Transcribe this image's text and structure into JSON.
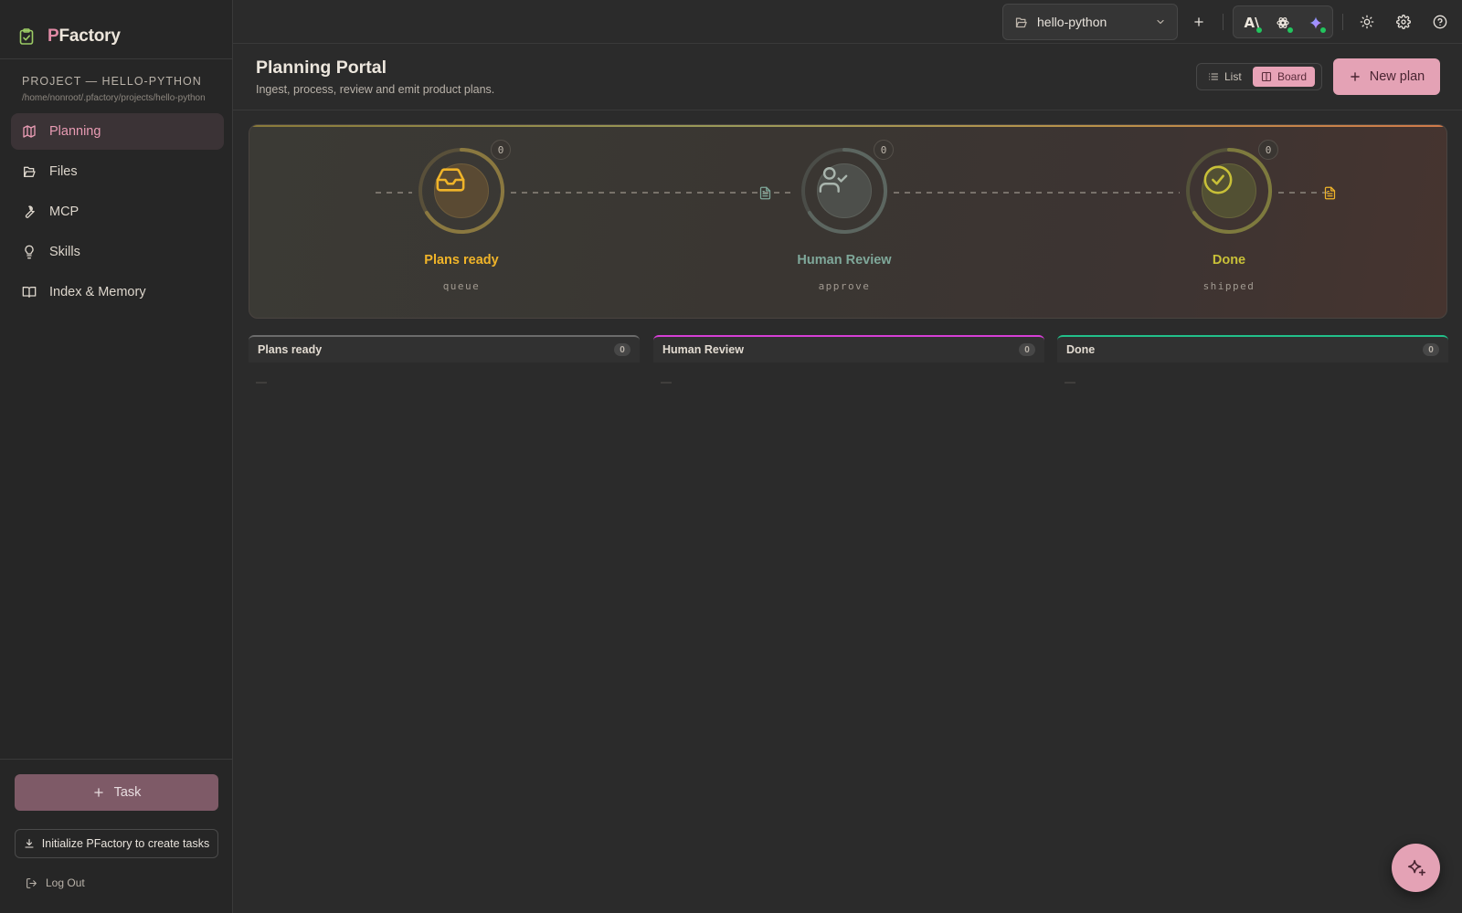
{
  "brand": {
    "prefix": "P",
    "name_rest": "Factory",
    "accent": "#e08aa5"
  },
  "project": {
    "label": "PROJECT — HELLO-PYTHON",
    "path": "/home/nonroot/.pfactory/projects/hello-python"
  },
  "sidebar": {
    "items": [
      {
        "label": "Planning",
        "icon": "map-icon",
        "active": true
      },
      {
        "label": "Files",
        "icon": "folder-open-icon",
        "active": false
      },
      {
        "label": "MCP",
        "icon": "wrench-icon",
        "active": false
      },
      {
        "label": "Skills",
        "icon": "lightbulb-icon",
        "active": false
      },
      {
        "label": "Index & Memory",
        "icon": "book-open-icon",
        "active": false
      }
    ],
    "task_button": "Task",
    "init_button": "Initialize PFactory to create tasks",
    "logout": "Log Out"
  },
  "topbar": {
    "project_select": {
      "value": "hello-python"
    },
    "agents": [
      {
        "icon": "anthropic-icon",
        "status": "online"
      },
      {
        "icon": "openai-icon",
        "status": "online"
      },
      {
        "icon": "gemini-sparkle-icon",
        "status": "online"
      }
    ]
  },
  "header": {
    "title": "Planning Portal",
    "subtitle": "Ingest, process, review and emit product plans.",
    "view_toggle": {
      "list": "List",
      "board": "Board",
      "selected": "Board"
    },
    "new_plan": "New plan"
  },
  "pipeline": {
    "stages": [
      {
        "name": "Plans ready",
        "sub": "queue",
        "count": "0",
        "color": "#f0b429",
        "icon": "inbox-icon"
      },
      {
        "name": "Human Review",
        "sub": "approve",
        "count": "0",
        "color": "#7fa89a",
        "icon": "user-check-icon"
      },
      {
        "name": "Done",
        "sub": "shipped",
        "count": "0",
        "color": "#c8c038",
        "icon": "check-circle-icon"
      }
    ]
  },
  "board": {
    "columns": [
      {
        "name": "Plans ready",
        "count": "0",
        "empty": "—",
        "color": "#6b6b6b"
      },
      {
        "name": "Human Review",
        "count": "0",
        "empty": "—",
        "color": "#d63fd6"
      },
      {
        "name": "Done",
        "count": "0",
        "empty": "—",
        "color": "#22c08a"
      }
    ]
  }
}
